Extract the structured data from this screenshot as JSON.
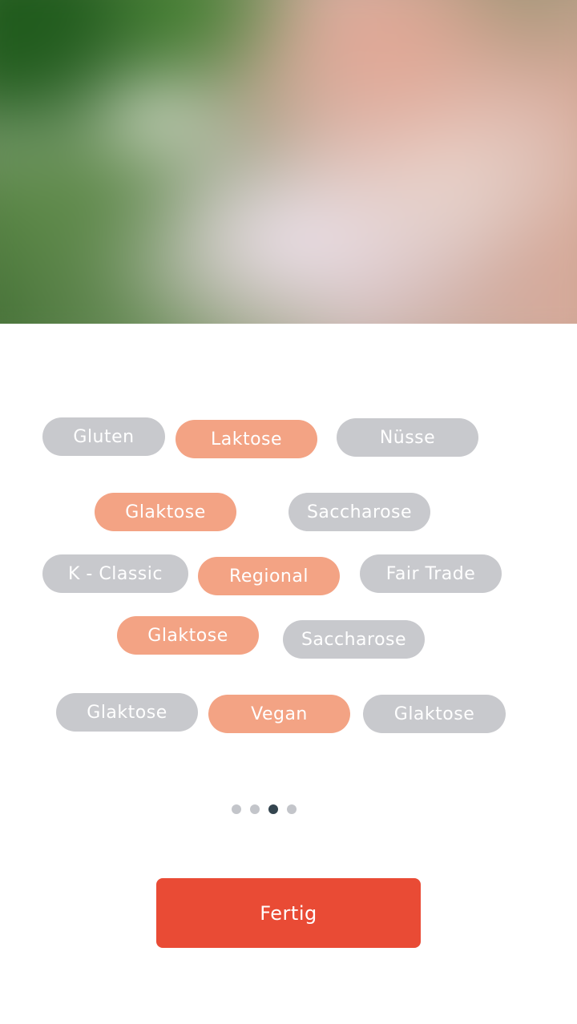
{
  "hero": {
    "image": "blurred-photo-person-in-garden"
  },
  "tags": [
    {
      "label": "Gluten",
      "selected": false
    },
    {
      "label": "Laktose",
      "selected": true
    },
    {
      "label": "Nüsse",
      "selected": false
    },
    {
      "label": "Glaktose",
      "selected": true
    },
    {
      "label": "Saccharose",
      "selected": false
    },
    {
      "label": "K - Classic",
      "selected": false
    },
    {
      "label": "Regional",
      "selected": true
    },
    {
      "label": "Fair Trade",
      "selected": false
    },
    {
      "label": "Glaktose",
      "selected": true
    },
    {
      "label": "Saccharose",
      "selected": false
    },
    {
      "label": "Glaktose",
      "selected": false
    },
    {
      "label": "Vegan",
      "selected": true
    },
    {
      "label": "Glaktose",
      "selected": false
    }
  ],
  "pagination": {
    "total": 4,
    "current": 3
  },
  "colors": {
    "selected": "#f3a384",
    "unselected": "#c8c9cd",
    "primary": "#e94b35",
    "dot_active": "#34454f",
    "dot_inactive": "#c3c5ca"
  },
  "actions": {
    "done_label": "Fertig"
  }
}
